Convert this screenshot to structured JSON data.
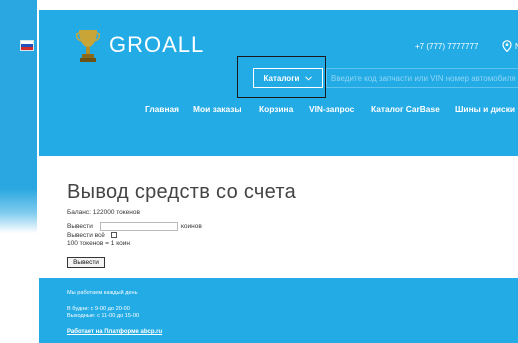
{
  "language": {
    "flag_colors": [
      "#ffffff",
      "#2450b8",
      "#d22b2b"
    ]
  },
  "header": {
    "logo_text": "GROALL",
    "phone": "+7 (777) 7777777",
    "location_partial": "N",
    "catalog_button": "Каталоги",
    "search_placeholder": "Введите код запчасти или VIN номер автомобиля",
    "accent_color": "#23abe6"
  },
  "nav": {
    "items": [
      "Главная",
      "Мои заказы",
      "Корзина",
      "VIN-запрос",
      "Каталог CarBase",
      "Шины и диски"
    ]
  },
  "main": {
    "title": "Вывод средств со счета",
    "balance": "Баланс: 122000 токенов",
    "withdraw_label": "Вывести",
    "amount_value": "",
    "unit": "коинов",
    "withdraw_all_label": "Вывести всё",
    "rate": "100 токенов = 1 коин",
    "withdraw_button": "Вывести"
  },
  "footer": {
    "line1": "Мы работаем каждый день",
    "line2": "В будни: с 9-00 до 20-00",
    "line3": "Выходные: с 11-00 до 15-00",
    "platform": "Работает на Платформе abcp.ru"
  }
}
